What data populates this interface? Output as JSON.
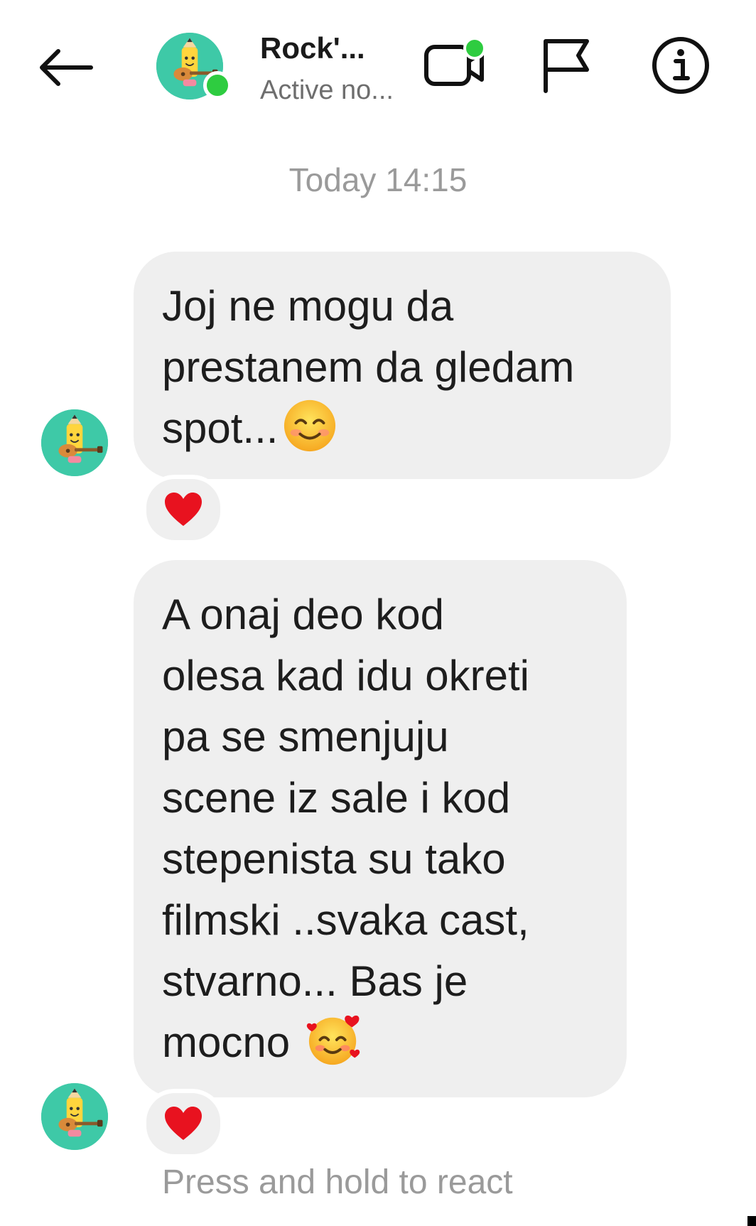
{
  "header": {
    "back_icon": "arrow-left-icon",
    "contact_name": "Rock'...",
    "contact_status": "Active no...",
    "online_color": "#2ecc40",
    "avatar_color": "#3ec9a7",
    "video_icon": "video-call-icon",
    "flag_icon": "flag-icon",
    "info_icon": "info-icon"
  },
  "conversation": {
    "timestamp": "Today 14:15",
    "messages": [
      {
        "lines": [
          "Joj ne mogu da",
          "prestanem da gledam",
          "spot..."
        ],
        "emoji": "smiling-face-icon",
        "reaction": "heart-icon"
      },
      {
        "lines": [
          "A onaj deo kod",
          "olesa kad idu okreti",
          "pa se smenjuju",
          "scene iz sale i kod",
          "stepenista su tako",
          "filmski ..svaka cast,",
          "stvarno... Bas je",
          "mocno"
        ],
        "emoji": "smiling-face-with-hearts-icon",
        "reaction": "heart-icon"
      }
    ],
    "hint": "Press and hold to react"
  },
  "colors": {
    "bubble": "#efefef",
    "accent_green": "#2ecc40",
    "heart": "#e8121f"
  }
}
